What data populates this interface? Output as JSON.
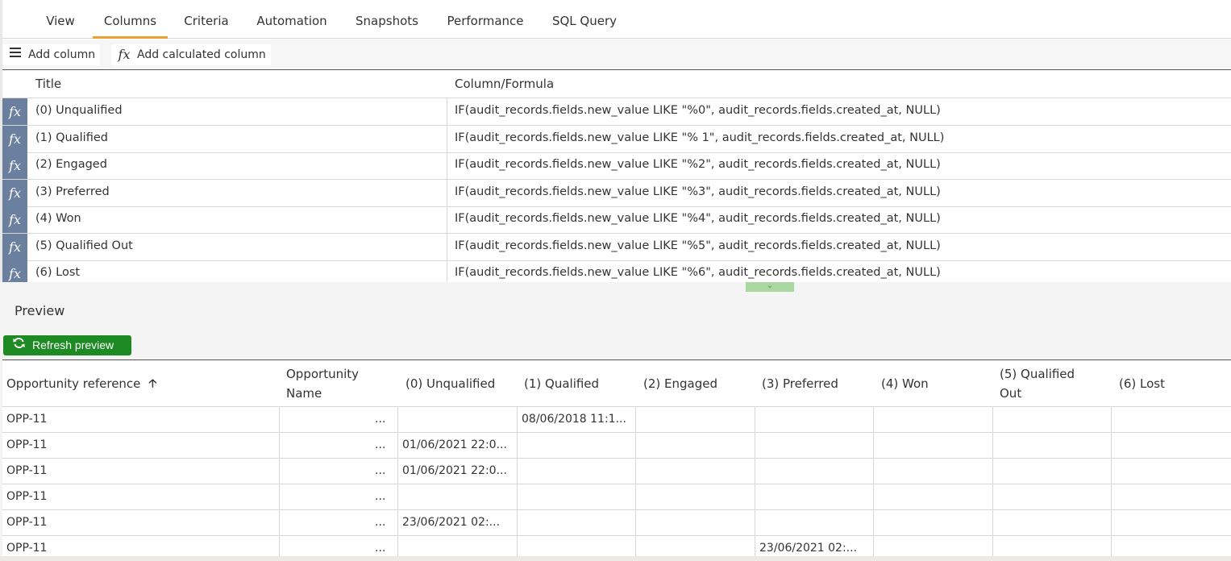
{
  "tabs": [
    {
      "label": "View"
    },
    {
      "label": "Columns",
      "active": true
    },
    {
      "label": "Criteria"
    },
    {
      "label": "Automation"
    },
    {
      "label": "Snapshots"
    },
    {
      "label": "Performance"
    },
    {
      "label": "SQL Query"
    }
  ],
  "toolbar": {
    "add_column": {
      "label": "Add column",
      "icon": "list-icon"
    },
    "add_calculated": {
      "label": "Add calculated column",
      "icon": "fx-icon",
      "glyph": "fx"
    }
  },
  "columns_table": {
    "headers": {
      "title": "Title",
      "formula": "Column/Formula"
    },
    "row_icon": "fx",
    "rows": [
      {
        "title": "(0) Unqualified",
        "formula": "IF(audit_records.fields.new_value LIKE \"%0\", audit_records.fields.created_at, NULL)"
      },
      {
        "title": "(1) Qualified",
        "formula": "IF(audit_records.fields.new_value LIKE \"% 1\", audit_records.fields.created_at, NULL)"
      },
      {
        "title": "(2) Engaged",
        "formula": "IF(audit_records.fields.new_value LIKE \"%2\", audit_records.fields.created_at, NULL)"
      },
      {
        "title": "(3) Preferred",
        "formula": "IF(audit_records.fields.new_value LIKE \"%3\", audit_records.fields.created_at, NULL)"
      },
      {
        "title": "(4) Won",
        "formula": "IF(audit_records.fields.new_value LIKE \"%4\", audit_records.fields.created_at, NULL)"
      },
      {
        "title": "(5) Qualified Out",
        "formula": "IF(audit_records.fields.new_value LIKE \"%5\", audit_records.fields.created_at, NULL)"
      },
      {
        "title": "(6) Lost",
        "formula": "IF(audit_records.fields.new_value LIKE \"%6\", audit_records.fields.created_at, NULL)"
      }
    ]
  },
  "preview": {
    "title": "Preview",
    "refresh_label": "Refresh preview",
    "colors": {
      "refresh_bg": "#1e8a23",
      "tab_accent": "#f0a030",
      "fx_bg": "#6b7f9e"
    }
  },
  "grid": {
    "headers": [
      {
        "line1": "Opportunity reference",
        "line2": "",
        "sorted": "ascending"
      },
      {
        "line1": "Opportunity",
        "line2": "Name"
      },
      {
        "line1": "(0) Unqualified",
        "line2": ""
      },
      {
        "line1": "(1) Qualified",
        "line2": ""
      },
      {
        "line1": "(2) Engaged",
        "line2": ""
      },
      {
        "line1": "(3) Preferred",
        "line2": ""
      },
      {
        "line1": "(4) Won",
        "line2": ""
      },
      {
        "line1": "(5) Qualified",
        "line2": "Out"
      },
      {
        "line1": "(6) Lost",
        "line2": ""
      }
    ],
    "ellipsis": "...",
    "rows": [
      [
        "OPP-11",
        "",
        "",
        "08/06/2018 11:1...",
        "",
        "",
        "",
        "",
        ""
      ],
      [
        "OPP-11",
        "",
        "01/06/2021 22:0...",
        "",
        "",
        "",
        "",
        "",
        ""
      ],
      [
        "OPP-11",
        "",
        "01/06/2021 22:0...",
        "",
        "",
        "",
        "",
        "",
        ""
      ],
      [
        "OPP-11",
        "",
        "",
        "",
        "",
        "",
        "",
        "",
        ""
      ],
      [
        "OPP-11",
        "",
        "23/06/2021 02:...",
        "",
        "",
        "",
        "",
        "",
        ""
      ],
      [
        "OPP-11",
        "",
        "",
        "",
        "",
        "23/06/2021 02:...",
        "",
        "",
        ""
      ]
    ]
  }
}
